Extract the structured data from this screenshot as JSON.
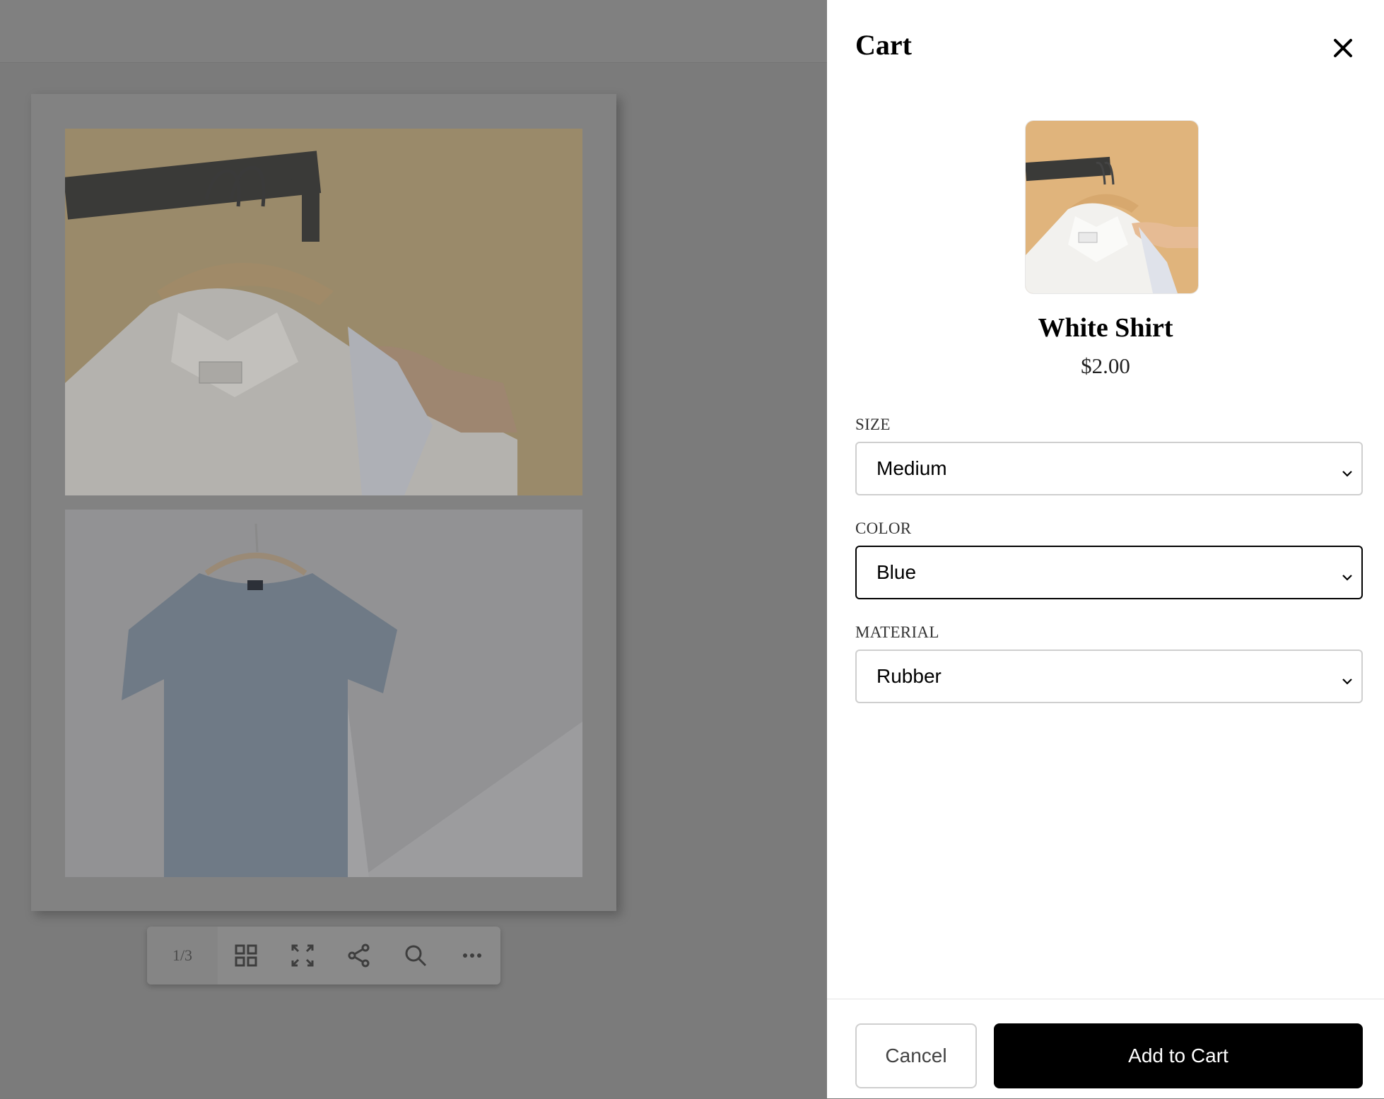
{
  "viewer": {
    "page_counter": "1/3",
    "toolbar_icons": [
      "grid-icon",
      "fullscreen-icon",
      "share-icon",
      "search-icon",
      "more-icon"
    ]
  },
  "cart": {
    "title": "Cart",
    "product": {
      "name": "White Shirt",
      "price": "$2.00"
    },
    "fields": {
      "size": {
        "label": "SIZE",
        "value": "Medium"
      },
      "color": {
        "label": "COLOR",
        "value": "Blue"
      },
      "material": {
        "label": "MATERIAL",
        "value": "Rubber"
      }
    },
    "buttons": {
      "cancel": "Cancel",
      "add": "Add to Cart"
    }
  },
  "colors": {
    "overlay": "#7a7a7a",
    "primary_button": "#000000",
    "drawer_bg": "#ffffff"
  }
}
